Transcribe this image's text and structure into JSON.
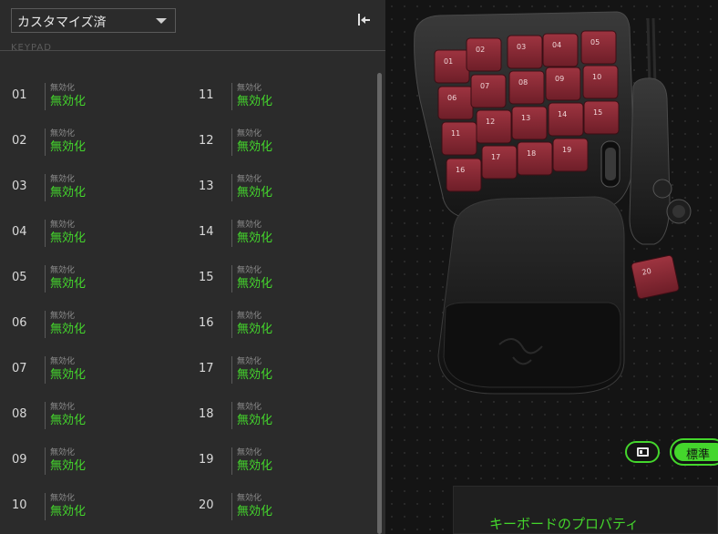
{
  "profile": {
    "selected": "カスタマイズ済"
  },
  "section": {
    "label": "KEYPAD"
  },
  "keys_left": [
    {
      "num": "01",
      "sub": "無効化",
      "action": "無効化"
    },
    {
      "num": "02",
      "sub": "無効化",
      "action": "無効化"
    },
    {
      "num": "03",
      "sub": "無効化",
      "action": "無効化"
    },
    {
      "num": "04",
      "sub": "無効化",
      "action": "無効化"
    },
    {
      "num": "05",
      "sub": "無効化",
      "action": "無効化"
    },
    {
      "num": "06",
      "sub": "無効化",
      "action": "無効化"
    },
    {
      "num": "07",
      "sub": "無効化",
      "action": "無効化"
    },
    {
      "num": "08",
      "sub": "無効化",
      "action": "無効化"
    },
    {
      "num": "09",
      "sub": "無効化",
      "action": "無効化"
    },
    {
      "num": "10",
      "sub": "無効化",
      "action": "無効化"
    }
  ],
  "keys_right": [
    {
      "num": "11",
      "sub": "無効化",
      "action": "無効化"
    },
    {
      "num": "12",
      "sub": "無効化",
      "action": "無効化"
    },
    {
      "num": "13",
      "sub": "無効化",
      "action": "無効化"
    },
    {
      "num": "14",
      "sub": "無効化",
      "action": "無効化"
    },
    {
      "num": "15",
      "sub": "無効化",
      "action": "無効化"
    },
    {
      "num": "16",
      "sub": "無効化",
      "action": "無効化"
    },
    {
      "num": "17",
      "sub": "無効化",
      "action": "無効化"
    },
    {
      "num": "18",
      "sub": "無効化",
      "action": "無効化"
    },
    {
      "num": "19",
      "sub": "無効化",
      "action": "無効化"
    },
    {
      "num": "20",
      "sub": "無効化",
      "action": "無効化"
    }
  ],
  "device_keys": [
    "01",
    "02",
    "03",
    "04",
    "05",
    "06",
    "07",
    "08",
    "09",
    "10",
    "11",
    "12",
    "13",
    "14",
    "15",
    "16",
    "17",
    "18",
    "19",
    "20"
  ],
  "view": {
    "standard_label": "標準"
  },
  "properties": {
    "title": "キーボードのプロパティ"
  },
  "colors": {
    "accent": "#44d62c",
    "keycap": "#8e2a34"
  },
  "icons": {
    "collapse": "collapse-left-icon",
    "caret": "chevron-down-icon",
    "layout": "layout-view-icon",
    "logo": "razer-logo-icon"
  }
}
